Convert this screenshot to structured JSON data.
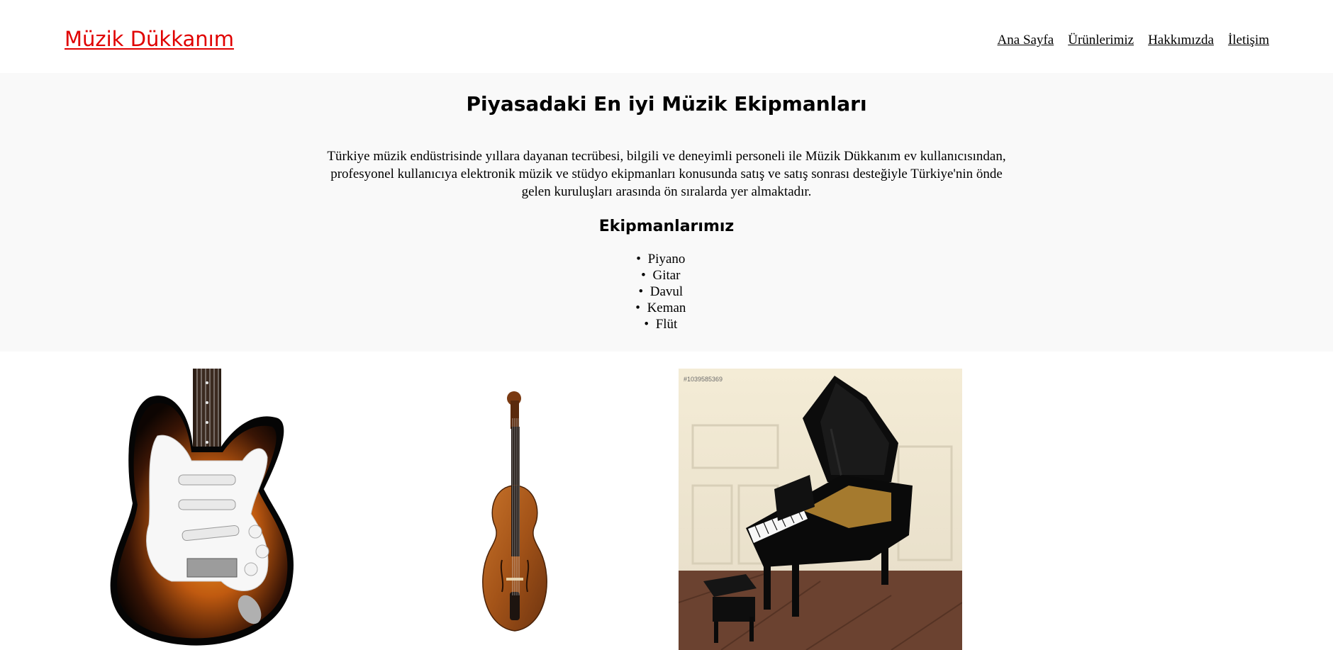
{
  "header": {
    "brand": "Müzik Dükkanım",
    "nav": [
      "Ana Sayfa",
      "Ürünlerimiz",
      "Hakkımızda",
      "İletişim"
    ]
  },
  "hero": {
    "title": "Piyasadaki En iyi Müzik Ekipmanları",
    "description": "Türkiye müzik endüstrisinde yıllara dayanan tecrübesi, bilgili ve deneyimli personeli ile Müzik Dükkanım ev kullanıcısından, profesyonel kullanıcıya elektronik müzik ve stüdyo ekipmanları konusunda satış ve satış sonrası desteğiyle Türkiye'nin önde gelen kuruluşları arasında ön sıralarda yer almaktadır.",
    "equipment_title": "Ekipmanlarımız",
    "equipment": [
      "Piyano",
      "Gitar",
      "Davul",
      "Keman",
      "Flüt"
    ]
  },
  "gallery": {
    "piano_watermark": "#1039585369"
  },
  "colors": {
    "brand": "#e00000",
    "hero_background": "#f9f9f9"
  }
}
